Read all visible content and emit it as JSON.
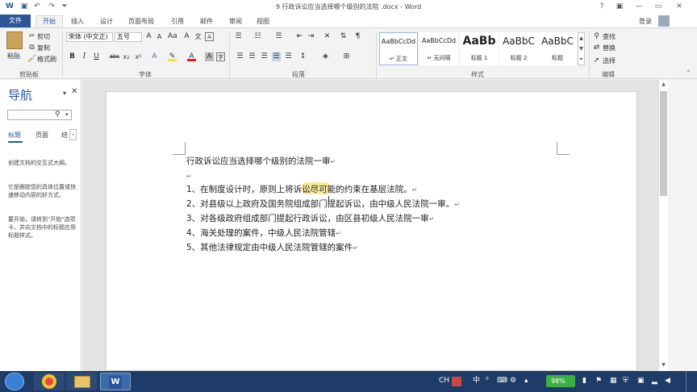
{
  "titlebar": {
    "title": "9 行政诉讼应当选择哪个级别的法院 .docx - Word",
    "help": "?",
    "ribbon_toggle": "▣",
    "minimize": "—",
    "restore": "▭",
    "close": "✕"
  },
  "tabs": {
    "file": "文件",
    "items": [
      "开始",
      "插入",
      "设计",
      "页面布局",
      "引用",
      "邮件",
      "审阅",
      "视图"
    ],
    "signin": "登录"
  },
  "clipboard": {
    "paste": "粘贴",
    "cut": "剪切",
    "copy": "复制",
    "format_painter": "格式刷",
    "group_label": "剪贴板"
  },
  "font": {
    "name": "宋体 (中文正)",
    "size": "五号",
    "bold": "B",
    "italic": "I",
    "underline": "U",
    "strike": "abc",
    "subscript": "x₂",
    "superscript": "x²",
    "group_label": "字体"
  },
  "paragraph": {
    "group_label": "段落"
  },
  "styles": {
    "items": [
      {
        "preview": "AaBbCcDd",
        "name": "↵ 正文"
      },
      {
        "preview": "AaBbCcDd",
        "name": "↵ 无间隔"
      },
      {
        "preview": "AaBb",
        "name": "标题 1"
      },
      {
        "preview": "AaBbC",
        "name": "标题 2"
      },
      {
        "preview": "AaBbC",
        "name": "标题"
      }
    ],
    "group_label": "样式"
  },
  "editing": {
    "find": "查找",
    "replace": "替换",
    "select": "选择",
    "group_label": "编辑"
  },
  "nav": {
    "title": "导航",
    "search_icon": "⚲",
    "tabs": [
      "标题",
      "页面",
      "结"
    ],
    "text1": "创建文档的交互式大纲。",
    "text2": "它是跟踪您的具体位置或快速移动内容的好方式。",
    "text3": "要开始，请转到\"开始\"选项卡，并向文档中的标题应用标题样式。"
  },
  "document": {
    "title": "行政诉讼应当选择哪个级别的法院一审",
    "para_mark": "↵",
    "lines": [
      "1、在制度设计时，原则上将诉讼尽可能的约束在基层法院。",
      "2、对县级以上政府及国务院组成部门提起诉讼，由中级人民法院一审。",
      "3、对各级政府组成部门提起行政诉讼，由区县初级人民法院一审",
      "4、海关处理的案件，中级人民法院管辖",
      "5、其他法律规定由中级人民法院管辖的案件"
    ]
  },
  "taskbar": {
    "ime": "CH",
    "ime_lang": "中",
    "battery": "98%",
    "colors": {
      "bar": "#1e3c67",
      "word": "#2b579a",
      "battery": "#3cb043"
    }
  },
  "colors": {
    "accent": "#2b579a",
    "highlight": "#f5e88a"
  }
}
